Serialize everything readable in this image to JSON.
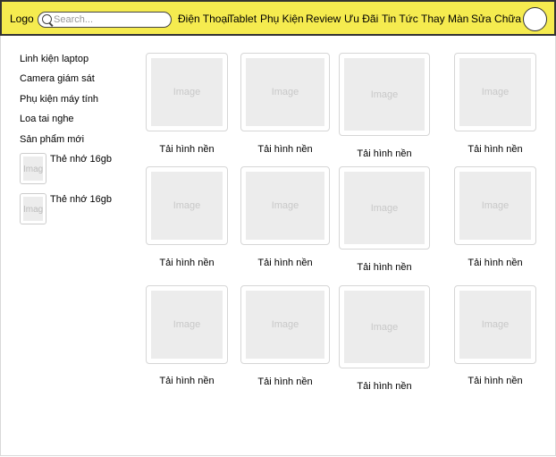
{
  "header": {
    "logo": "Logo",
    "search_placeholder": "Search...",
    "nav": [
      "Điện Thoại",
      "Tablet",
      "Phụ Kiện",
      "Review",
      "Ưu Đãi",
      "Tin Tức",
      "Thay Màn",
      "Sửa Chữa"
    ]
  },
  "sidebar": {
    "links": [
      "Linh kiện laptop",
      "Camera giám sát",
      "Phụ kiện máy tính",
      "Loa tai nghe",
      "Sản phẩm mới"
    ],
    "products": [
      {
        "thumb": "Image",
        "label": "Thẻ nhớ 16gb"
      },
      {
        "thumb": "Image",
        "label": "Thẻ nhớ 16gb"
      }
    ]
  },
  "grid": {
    "image_placeholder": "Image",
    "items": [
      "Tải hình nền",
      "Tải hình nền",
      "Tải hình nền",
      "Tải hình nền",
      "Tải hình nền",
      "Tải hình nền",
      "Tải hình nền",
      "Tải hình nền",
      "Tải hình nền",
      "Tải hình nền",
      "Tải hình nền",
      "Tải hình nền"
    ]
  }
}
